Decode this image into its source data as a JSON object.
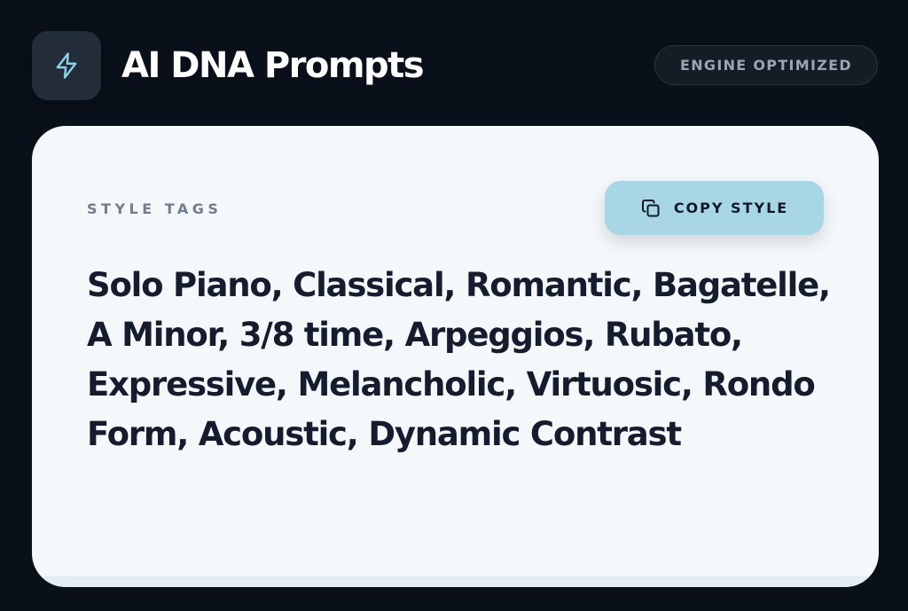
{
  "header": {
    "title": "AI DNA Prompts",
    "logo_icon": "lightning-bolt-icon",
    "badge": "ENGINE OPTIMIZED"
  },
  "card": {
    "section_label": "STYLE TAGS",
    "copy_button": {
      "label": "COPY STYLE",
      "icon": "copy-icon"
    },
    "tags": "Solo Piano, Classical, Romantic, Bagatelle, A Minor, 3/8 time, Arpeggios, Rubato, Expressive, Melancholic, Virtuosic, Rondo Form, Acoustic, Dynamic Contrast"
  },
  "colors": {
    "background": "#0a101a",
    "card_background": "#f5f8fb",
    "accent": "#a9d6e4",
    "icon_accent": "#8ed1e6"
  }
}
